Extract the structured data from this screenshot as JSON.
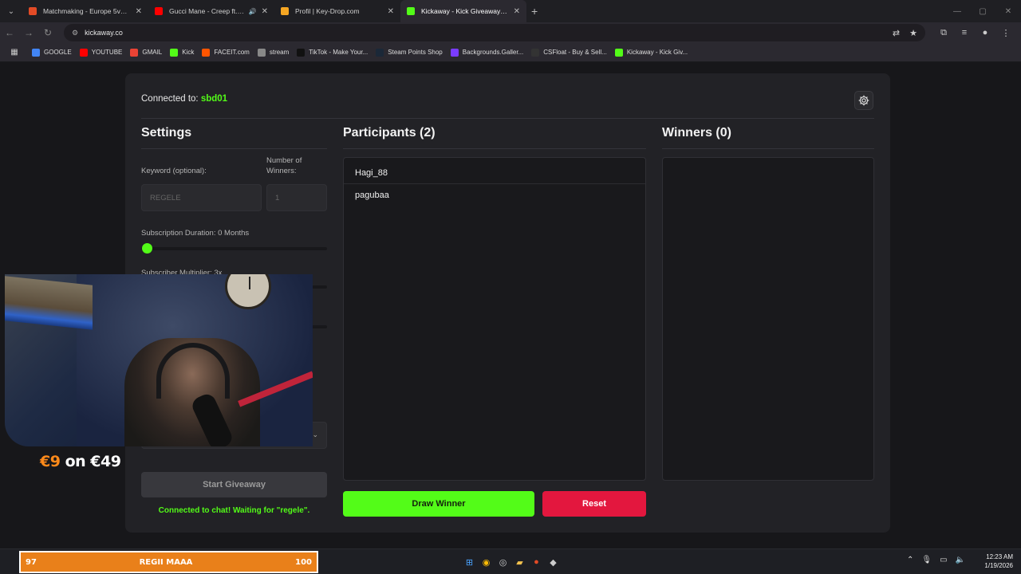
{
  "browser": {
    "tabs": [
      {
        "title": "Matchmaking - Europe 5v5 Qu",
        "color": "#e34b26"
      },
      {
        "title": "Gucci Mane - Creep ft. 21 S",
        "color": "#ff0000"
      },
      {
        "title": "Profil | Key-Drop.com",
        "color": "#f5a623"
      },
      {
        "title": "Kickaway - Kick Giveaway Tool",
        "color": "#53fc18"
      }
    ],
    "url": "kickaway.co",
    "bookmarks": [
      {
        "label": "GOOGLE",
        "color": "#4285f4"
      },
      {
        "label": "YOUTUBE",
        "color": "#ff0000"
      },
      {
        "label": "GMAIL",
        "color": "#ea4335"
      },
      {
        "label": "Kick",
        "color": "#53fc18"
      },
      {
        "label": "FACEIT.com",
        "color": "#ff5500"
      },
      {
        "label": "stream",
        "color": "#888888"
      },
      {
        "label": "TikTok - Make Your...",
        "color": "#111111"
      },
      {
        "label": "Steam Points Shop",
        "color": "#1b2838"
      },
      {
        "label": "Backgrounds.Galler...",
        "color": "#7a3cff"
      },
      {
        "label": "CSFloat - Buy & Sell...",
        "color": "#333333"
      },
      {
        "label": "Kickaway - Kick Giv...",
        "color": "#53fc18"
      }
    ]
  },
  "app": {
    "connected_label": "Connected to:",
    "channel": "sbd01",
    "settings": {
      "title": "Settings",
      "keyword_label": "Keyword (optional):",
      "keyword_placeholder": "REGELE",
      "winners_label": "Number of Winners:",
      "winners_placeholder": "1",
      "sub_duration_label": "Subscription Duration: 0 Months",
      "sub_multiplier_label": "Subscriber Multiplier: 3x",
      "start_button": "Start Giveaway",
      "status": "Connected to chat! Waiting for \"regele\"."
    },
    "participants": {
      "title": "Participants (2)",
      "list": [
        "Hagi_88",
        "pagubaa"
      ]
    },
    "winners": {
      "title": "Winners (0)",
      "list": []
    },
    "draw_button": "Draw Winner",
    "reset_button": "Reset",
    "accent": "#53fc18",
    "danger": "#e3173e"
  },
  "overlay": {
    "price_left": "€9",
    "price_mid": " on ",
    "price_right": "€49",
    "hp_left": "97",
    "hp_name": "REGII MAAA",
    "hp_right": "100"
  },
  "taskbar": {
    "time": "12:23 AM",
    "date": "1/19/2026"
  }
}
